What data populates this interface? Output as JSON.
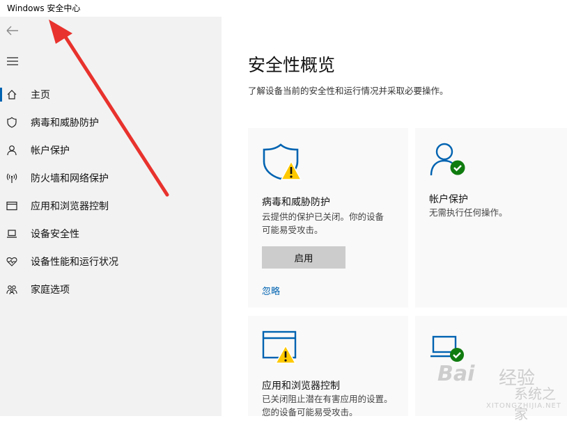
{
  "window": {
    "title": "Windows 安全中心"
  },
  "sidebar": {
    "back_icon": "back-arrow-icon",
    "menu_icon": "hamburger-menu-icon",
    "items": [
      {
        "label": "主页",
        "icon": "home-icon",
        "active": true
      },
      {
        "label": "病毒和威胁防护",
        "icon": "shield-icon"
      },
      {
        "label": "帐户保护",
        "icon": "person-icon"
      },
      {
        "label": "防火墙和网络保护",
        "icon": "wireless-antenna-icon"
      },
      {
        "label": "应用和浏览器控制",
        "icon": "app-window-icon"
      },
      {
        "label": "设备安全性",
        "icon": "laptop-icon"
      },
      {
        "label": "设备性能和运行状况",
        "icon": "heart-pulse-icon"
      },
      {
        "label": "家庭选项",
        "icon": "family-icon"
      }
    ]
  },
  "main": {
    "title": "安全性概览",
    "subtitle": "了解设备当前的安全性和运行情况并采取必要操作。",
    "cards": {
      "virus": {
        "title": "病毒和威胁防护",
        "desc_line1": "云提供的保护已关闭。你的设备",
        "desc_line2": "可能易受攻击。",
        "button": "启用",
        "link": "忽略"
      },
      "account": {
        "title": "帐户保护",
        "desc": "无需执行任何操作。"
      },
      "app": {
        "title": "应用和浏览器控制",
        "desc_line1": "已关闭阻止潜在有害应用的设置。",
        "desc_line2": "您的设备可能易受攻击。"
      }
    }
  },
  "colors": {
    "accent": "#0063b1",
    "warning": "#ffc900",
    "ok": "#107c10",
    "arrow": "#e8322d"
  },
  "watermark": {
    "brand": "Bai",
    "brand2": "经验",
    "site_cn": "系统之家",
    "site_url": "XITONGZHIJIA.NET"
  }
}
